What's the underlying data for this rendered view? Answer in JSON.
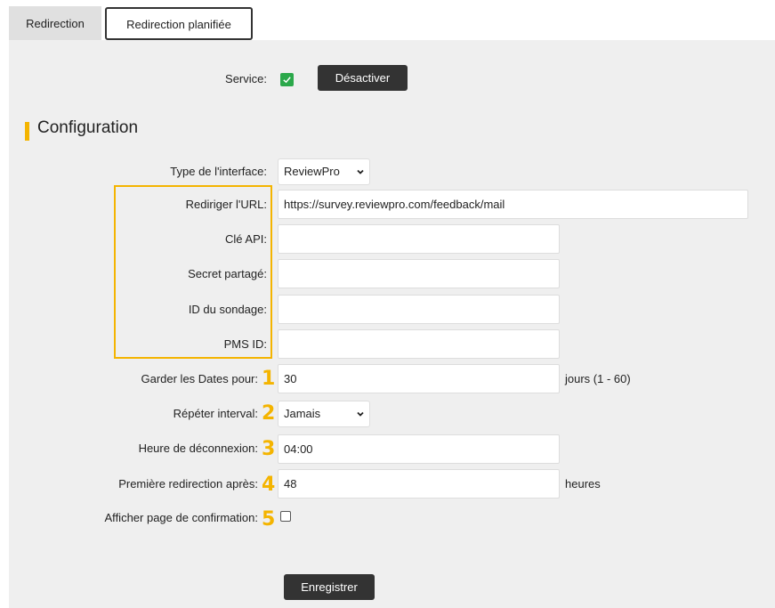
{
  "tabs": [
    {
      "label": "Redirection"
    },
    {
      "label": "Redirection planifiée"
    }
  ],
  "service": {
    "label": "Service:",
    "checked": true,
    "button_label": "Désactiver"
  },
  "section": {
    "title": "Configuration"
  },
  "fields": {
    "interface_type": {
      "label": "Type de l'interface:",
      "value": "ReviewPro"
    },
    "redirect_url": {
      "label": "Rediriger l'URL:",
      "value": "https://survey.reviewpro.com/feedback/mail"
    },
    "api_key": {
      "label": "Clé API:",
      "value": ""
    },
    "shared_secret": {
      "label": "Secret partagé:",
      "value": ""
    },
    "survey_id": {
      "label": "ID du sondage:",
      "value": ""
    },
    "pms_id": {
      "label": "PMS ID:",
      "value": ""
    },
    "keep_dates": {
      "label": "Garder les Dates pour:",
      "value": "30",
      "unit": "jours (1 - 60)",
      "badge": "1"
    },
    "repeat_interval": {
      "label": "Répéter interval:",
      "value": "Jamais",
      "badge": "2"
    },
    "logout_time": {
      "label": "Heure de déconnexion:",
      "value": "04:00",
      "badge": "3"
    },
    "first_redirect": {
      "label": "Première redirection après:",
      "value": "48",
      "unit": "heures",
      "badge": "4"
    },
    "show_confirmation": {
      "label": "Afficher page de confirmation:",
      "checked": false,
      "badge": "5"
    }
  },
  "actions": {
    "save_label": "Enregistrer"
  },
  "colors": {
    "accent": "#f4b400",
    "checkbox_green": "#2ba84a",
    "button_dark": "#333333",
    "panel_bg": "#efefef"
  }
}
